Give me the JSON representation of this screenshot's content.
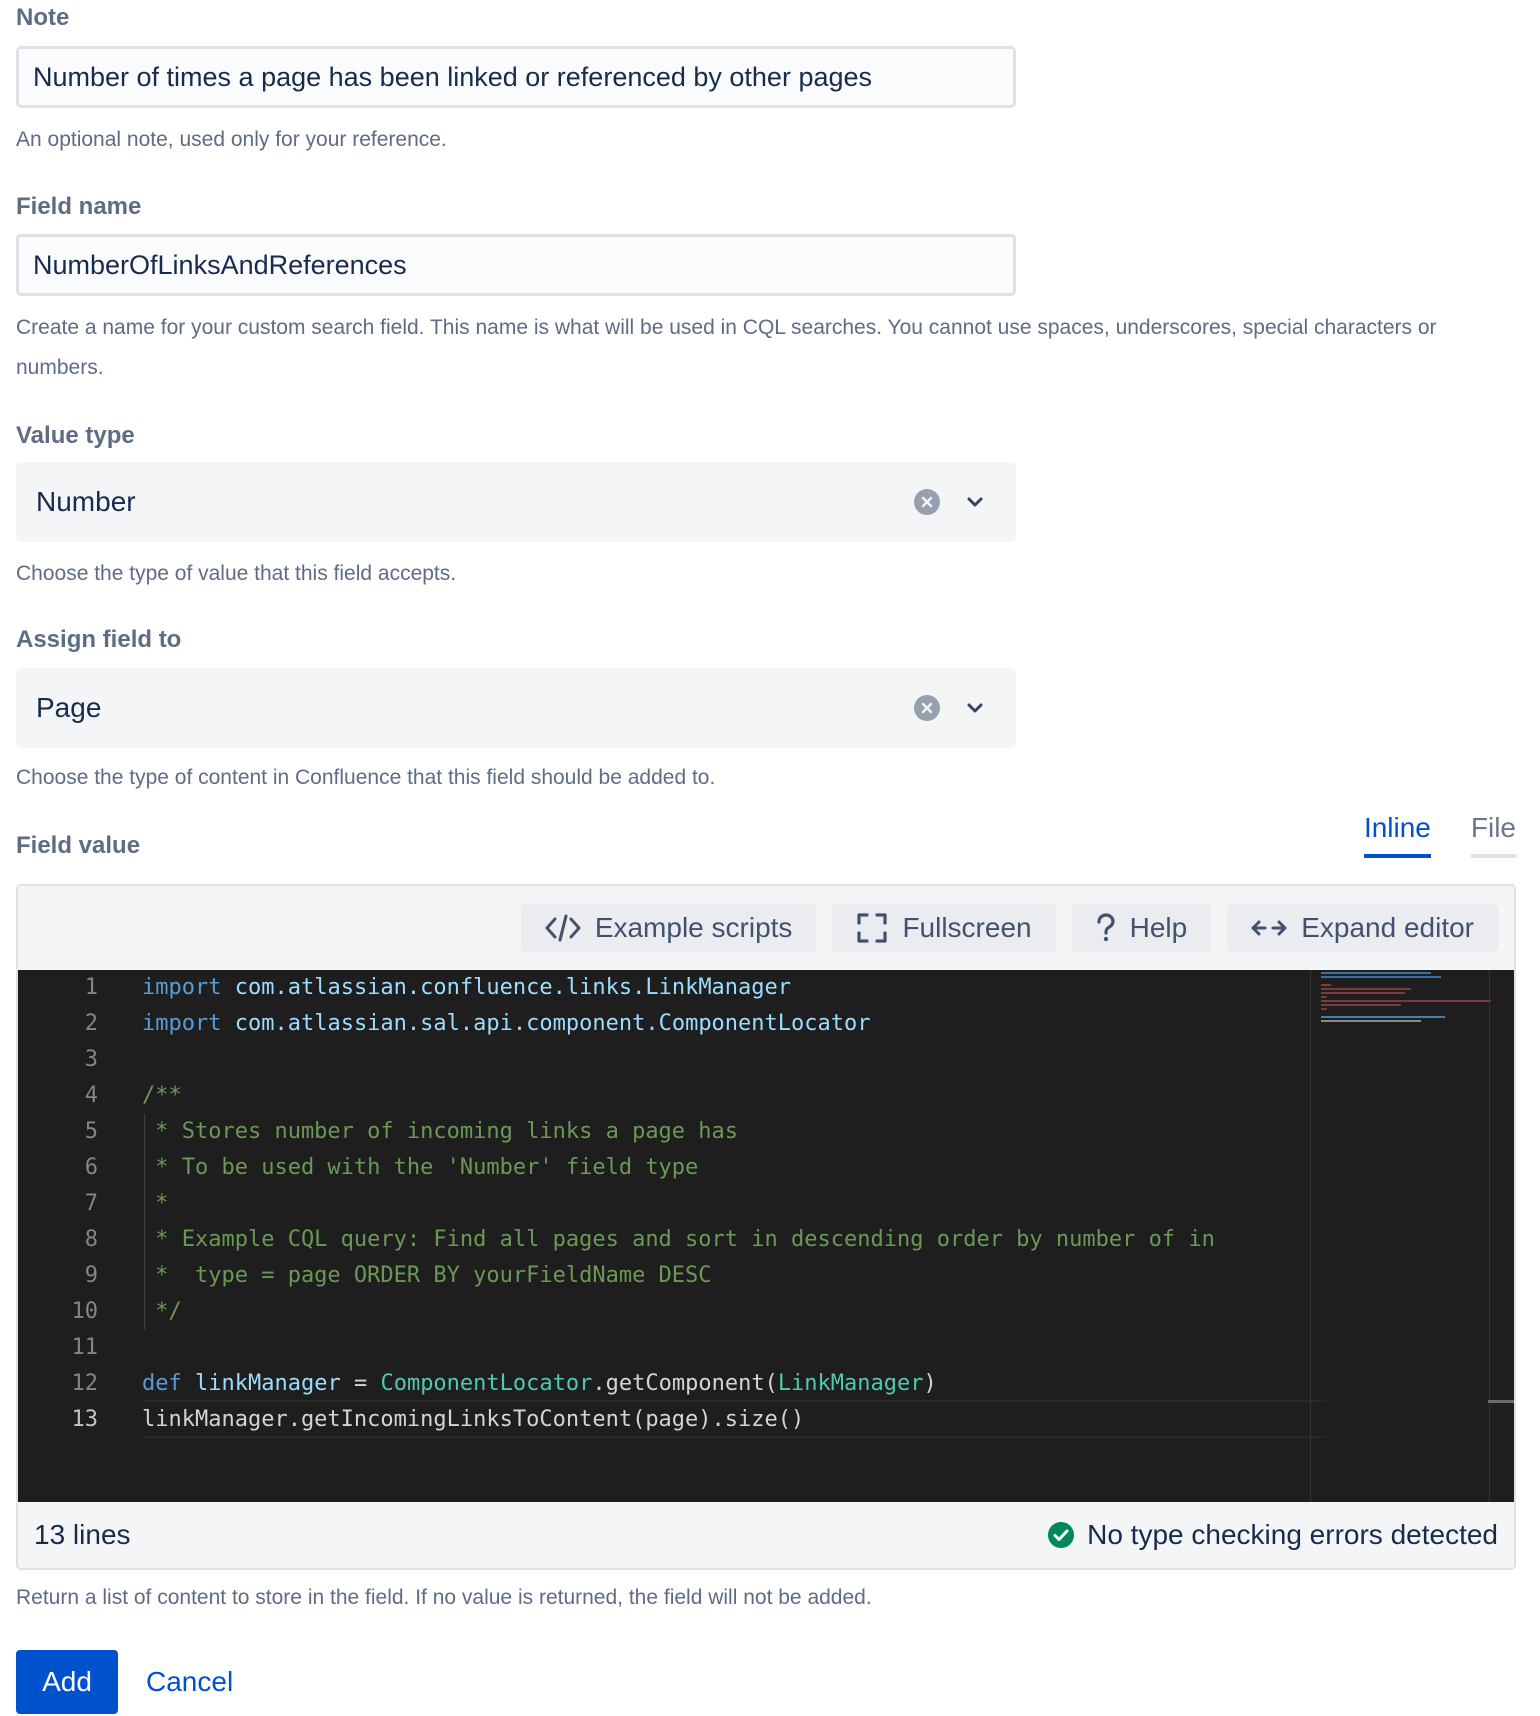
{
  "note": {
    "label": "Note",
    "value": "Number of times a page has been linked or referenced by other pages",
    "help": "An optional note, used only for your reference."
  },
  "field_name": {
    "label": "Field name",
    "value": "NumberOfLinksAndReferences",
    "help": "Create a name for your custom search field. This name is what will be used in CQL searches. You cannot use spaces, underscores, special characters or numbers."
  },
  "value_type": {
    "label": "Value type",
    "value": "Number",
    "help": "Choose the type of value that this field accepts."
  },
  "assign_field": {
    "label": "Assign field to",
    "value": "Page",
    "help": "Choose the type of content in Confluence that this field should be added to."
  },
  "field_value": {
    "label": "Field value",
    "tabs": [
      {
        "label": "Inline",
        "active": true
      },
      {
        "label": "File",
        "active": false
      }
    ],
    "toolbar": {
      "example_scripts": "Example scripts",
      "fullscreen": "Fullscreen",
      "help": "Help",
      "expand_editor": "Expand editor"
    },
    "code_lines": [
      "import com.atlassian.confluence.links.LinkManager",
      "import com.atlassian.sal.api.component.ComponentLocator",
      "",
      "/**",
      " * Stores number of incoming links a page has",
      " * To be used with the 'Number' field type",
      " *",
      " * Example CQL query: Find all pages and sort in descending order by number of in",
      " *  type = page ORDER BY yourFieldName DESC",
      " */",
      "",
      "def linkManager = ComponentLocator.getComponent(LinkManager)",
      "linkManager.getIncomingLinksToContent(page).size()"
    ],
    "line_numbers": [
      "1",
      "2",
      "3",
      "4",
      "5",
      "6",
      "7",
      "8",
      "9",
      "10",
      "11",
      "12",
      "13"
    ],
    "active_line": 13,
    "line_count": "13 lines",
    "status": "No type checking errors detected",
    "help": "Return a list of content to store in the field. If no value is returned, the field will not be added."
  },
  "actions": {
    "add": "Add",
    "cancel": "Cancel"
  },
  "colors": {
    "primary": "#0052cc",
    "success": "#00875a",
    "editor_bg": "#1e1e1e"
  }
}
